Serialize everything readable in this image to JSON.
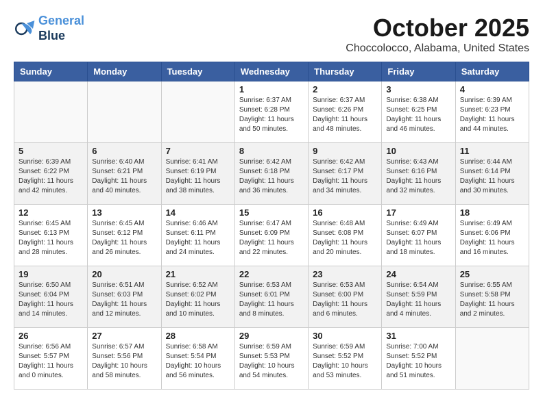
{
  "header": {
    "logo_line1": "General",
    "logo_line2": "Blue",
    "month": "October 2025",
    "location": "Choccolocco, Alabama, United States"
  },
  "weekdays": [
    "Sunday",
    "Monday",
    "Tuesday",
    "Wednesday",
    "Thursday",
    "Friday",
    "Saturday"
  ],
  "weeks": [
    [
      {
        "day": "",
        "sunrise": "",
        "sunset": "",
        "daylight": "",
        "empty": true
      },
      {
        "day": "",
        "sunrise": "",
        "sunset": "",
        "daylight": "",
        "empty": true
      },
      {
        "day": "",
        "sunrise": "",
        "sunset": "",
        "daylight": "",
        "empty": true
      },
      {
        "day": "1",
        "sunrise": "Sunrise: 6:37 AM",
        "sunset": "Sunset: 6:28 PM",
        "daylight": "Daylight: 11 hours and 50 minutes.",
        "empty": false
      },
      {
        "day": "2",
        "sunrise": "Sunrise: 6:37 AM",
        "sunset": "Sunset: 6:26 PM",
        "daylight": "Daylight: 11 hours and 48 minutes.",
        "empty": false
      },
      {
        "day": "3",
        "sunrise": "Sunrise: 6:38 AM",
        "sunset": "Sunset: 6:25 PM",
        "daylight": "Daylight: 11 hours and 46 minutes.",
        "empty": false
      },
      {
        "day": "4",
        "sunrise": "Sunrise: 6:39 AM",
        "sunset": "Sunset: 6:23 PM",
        "daylight": "Daylight: 11 hours and 44 minutes.",
        "empty": false
      }
    ],
    [
      {
        "day": "5",
        "sunrise": "Sunrise: 6:39 AM",
        "sunset": "Sunset: 6:22 PM",
        "daylight": "Daylight: 11 hours and 42 minutes.",
        "empty": false
      },
      {
        "day": "6",
        "sunrise": "Sunrise: 6:40 AM",
        "sunset": "Sunset: 6:21 PM",
        "daylight": "Daylight: 11 hours and 40 minutes.",
        "empty": false
      },
      {
        "day": "7",
        "sunrise": "Sunrise: 6:41 AM",
        "sunset": "Sunset: 6:19 PM",
        "daylight": "Daylight: 11 hours and 38 minutes.",
        "empty": false
      },
      {
        "day": "8",
        "sunrise": "Sunrise: 6:42 AM",
        "sunset": "Sunset: 6:18 PM",
        "daylight": "Daylight: 11 hours and 36 minutes.",
        "empty": false
      },
      {
        "day": "9",
        "sunrise": "Sunrise: 6:42 AM",
        "sunset": "Sunset: 6:17 PM",
        "daylight": "Daylight: 11 hours and 34 minutes.",
        "empty": false
      },
      {
        "day": "10",
        "sunrise": "Sunrise: 6:43 AM",
        "sunset": "Sunset: 6:16 PM",
        "daylight": "Daylight: 11 hours and 32 minutes.",
        "empty": false
      },
      {
        "day": "11",
        "sunrise": "Sunrise: 6:44 AM",
        "sunset": "Sunset: 6:14 PM",
        "daylight": "Daylight: 11 hours and 30 minutes.",
        "empty": false
      }
    ],
    [
      {
        "day": "12",
        "sunrise": "Sunrise: 6:45 AM",
        "sunset": "Sunset: 6:13 PM",
        "daylight": "Daylight: 11 hours and 28 minutes.",
        "empty": false
      },
      {
        "day": "13",
        "sunrise": "Sunrise: 6:45 AM",
        "sunset": "Sunset: 6:12 PM",
        "daylight": "Daylight: 11 hours and 26 minutes.",
        "empty": false
      },
      {
        "day": "14",
        "sunrise": "Sunrise: 6:46 AM",
        "sunset": "Sunset: 6:11 PM",
        "daylight": "Daylight: 11 hours and 24 minutes.",
        "empty": false
      },
      {
        "day": "15",
        "sunrise": "Sunrise: 6:47 AM",
        "sunset": "Sunset: 6:09 PM",
        "daylight": "Daylight: 11 hours and 22 minutes.",
        "empty": false
      },
      {
        "day": "16",
        "sunrise": "Sunrise: 6:48 AM",
        "sunset": "Sunset: 6:08 PM",
        "daylight": "Daylight: 11 hours and 20 minutes.",
        "empty": false
      },
      {
        "day": "17",
        "sunrise": "Sunrise: 6:49 AM",
        "sunset": "Sunset: 6:07 PM",
        "daylight": "Daylight: 11 hours and 18 minutes.",
        "empty": false
      },
      {
        "day": "18",
        "sunrise": "Sunrise: 6:49 AM",
        "sunset": "Sunset: 6:06 PM",
        "daylight": "Daylight: 11 hours and 16 minutes.",
        "empty": false
      }
    ],
    [
      {
        "day": "19",
        "sunrise": "Sunrise: 6:50 AM",
        "sunset": "Sunset: 6:04 PM",
        "daylight": "Daylight: 11 hours and 14 minutes.",
        "empty": false
      },
      {
        "day": "20",
        "sunrise": "Sunrise: 6:51 AM",
        "sunset": "Sunset: 6:03 PM",
        "daylight": "Daylight: 11 hours and 12 minutes.",
        "empty": false
      },
      {
        "day": "21",
        "sunrise": "Sunrise: 6:52 AM",
        "sunset": "Sunset: 6:02 PM",
        "daylight": "Daylight: 11 hours and 10 minutes.",
        "empty": false
      },
      {
        "day": "22",
        "sunrise": "Sunrise: 6:53 AM",
        "sunset": "Sunset: 6:01 PM",
        "daylight": "Daylight: 11 hours and 8 minutes.",
        "empty": false
      },
      {
        "day": "23",
        "sunrise": "Sunrise: 6:53 AM",
        "sunset": "Sunset: 6:00 PM",
        "daylight": "Daylight: 11 hours and 6 minutes.",
        "empty": false
      },
      {
        "day": "24",
        "sunrise": "Sunrise: 6:54 AM",
        "sunset": "Sunset: 5:59 PM",
        "daylight": "Daylight: 11 hours and 4 minutes.",
        "empty": false
      },
      {
        "day": "25",
        "sunrise": "Sunrise: 6:55 AM",
        "sunset": "Sunset: 5:58 PM",
        "daylight": "Daylight: 11 hours and 2 minutes.",
        "empty": false
      }
    ],
    [
      {
        "day": "26",
        "sunrise": "Sunrise: 6:56 AM",
        "sunset": "Sunset: 5:57 PM",
        "daylight": "Daylight: 11 hours and 0 minutes.",
        "empty": false
      },
      {
        "day": "27",
        "sunrise": "Sunrise: 6:57 AM",
        "sunset": "Sunset: 5:56 PM",
        "daylight": "Daylight: 10 hours and 58 minutes.",
        "empty": false
      },
      {
        "day": "28",
        "sunrise": "Sunrise: 6:58 AM",
        "sunset": "Sunset: 5:54 PM",
        "daylight": "Daylight: 10 hours and 56 minutes.",
        "empty": false
      },
      {
        "day": "29",
        "sunrise": "Sunrise: 6:59 AM",
        "sunset": "Sunset: 5:53 PM",
        "daylight": "Daylight: 10 hours and 54 minutes.",
        "empty": false
      },
      {
        "day": "30",
        "sunrise": "Sunrise: 6:59 AM",
        "sunset": "Sunset: 5:52 PM",
        "daylight": "Daylight: 10 hours and 53 minutes.",
        "empty": false
      },
      {
        "day": "31",
        "sunrise": "Sunrise: 7:00 AM",
        "sunset": "Sunset: 5:52 PM",
        "daylight": "Daylight: 10 hours and 51 minutes.",
        "empty": false
      },
      {
        "day": "",
        "sunrise": "",
        "sunset": "",
        "daylight": "",
        "empty": true
      }
    ]
  ]
}
